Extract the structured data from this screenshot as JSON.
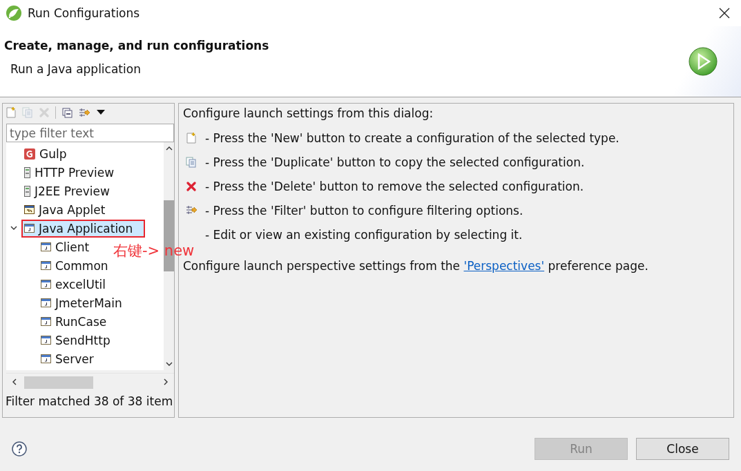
{
  "window": {
    "title": "Run Configurations"
  },
  "header": {
    "title": "Create, manage, and run configurations",
    "subtitle": "Run a Java application"
  },
  "toolbar": [
    {
      "kind": "new",
      "disabled": false
    },
    {
      "kind": "duplicate",
      "disabled": true
    },
    {
      "kind": "delete",
      "disabled": true
    },
    {
      "kind": "collapse",
      "disabled": false
    },
    {
      "kind": "filter",
      "disabled": false
    },
    {
      "kind": "menu",
      "disabled": false
    }
  ],
  "filter": {
    "placeholder": "type filter text"
  },
  "tree": [
    {
      "label": "Gulp",
      "kind": "gulp",
      "selected": false,
      "annotated": false
    },
    {
      "label": "HTTP Preview",
      "kind": "server",
      "selected": false,
      "annotated": false
    },
    {
      "label": "J2EE Preview",
      "kind": "server",
      "selected": false,
      "annotated": false
    },
    {
      "label": "Java Applet",
      "kind": "applet",
      "selected": false,
      "annotated": false
    },
    {
      "label": "Java Application",
      "kind": "app",
      "selected": true,
      "annotated": true,
      "expanded": true,
      "children": [
        {
          "label": "Client",
          "kind": "app",
          "selected": false,
          "annotated": false
        },
        {
          "label": "Common",
          "kind": "app",
          "selected": false,
          "annotated": false
        },
        {
          "label": "excelUtil",
          "kind": "app",
          "selected": false,
          "annotated": false
        },
        {
          "label": "JmeterMain",
          "kind": "app",
          "selected": false,
          "annotated": false
        },
        {
          "label": "RunCase",
          "kind": "app",
          "selected": false,
          "annotated": false
        },
        {
          "label": "SendHttp",
          "kind": "app",
          "selected": false,
          "annotated": false
        },
        {
          "label": "Server",
          "kind": "app",
          "selected": false,
          "annotated": false
        }
      ]
    }
  ],
  "annotation": "右键-> new",
  "status": "Filter matched 38 of 38 item",
  "info": {
    "intro": "Configure launch settings from this dialog:",
    "items": [
      {
        "kind": "new",
        "text": "- Press the 'New' button to create a configuration of the selected type."
      },
      {
        "kind": "duplicate",
        "text": "- Press the 'Duplicate' button to copy the selected configuration."
      },
      {
        "kind": "delete",
        "text": "- Press the 'Delete' button to remove the selected configuration."
      },
      {
        "kind": "filter",
        "text": "- Press the 'Filter' button to configure filtering options."
      },
      {
        "kind": "none",
        "text": "- Edit or view an existing configuration by selecting it."
      }
    ],
    "footer_before": "Configure launch perspective settings from the",
    "link": "'Perspectives'",
    "footer_after": "preference page."
  },
  "buttons": [
    {
      "label": "Run",
      "disabled": true
    },
    {
      "label": "Close",
      "disabled": false
    }
  ]
}
